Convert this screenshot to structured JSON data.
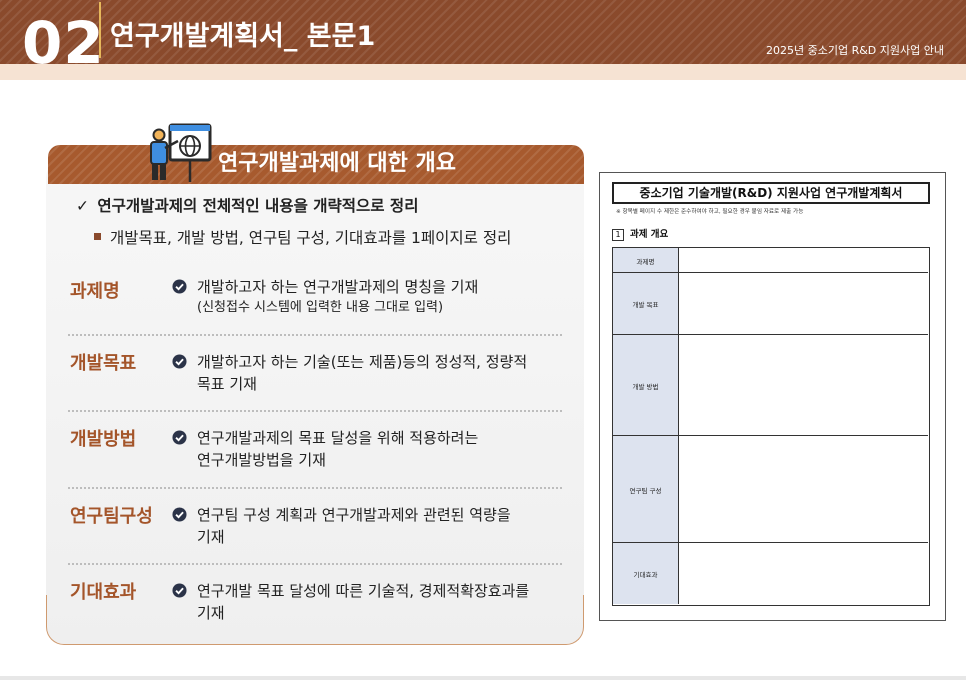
{
  "header": {
    "chapter_number": "02",
    "title": "연구개발계획서_ 본문1",
    "subtitle": "2025년 중소기업 R&D 지원사업 안내"
  },
  "section": {
    "title": "연구개발과제에 대한 개요",
    "icon": "presenter-globe-icon",
    "check_text": "연구개발과제의 전체적인 내용을 개략적으로 정리",
    "bullet_text": "개발목표, 개발 방법, 연구팀 구성, 기대효과를 1페이지로 정리"
  },
  "rows": [
    {
      "label": "과제명",
      "lines": [
        "개발하고자 하는 연구개발과제의 명칭을 기재"
      ],
      "note": "(신청접수 시스템에 입력한 내용 그대로 입력)"
    },
    {
      "label": "개발목표",
      "lines": [
        "개발하고자 하는 기술(또는 제품)등의 정성적, 정량적",
        "목표 기재"
      ]
    },
    {
      "label": "개발방법",
      "lines": [
        "연구개발과제의 목표 달성을 위해 적용하려는",
        "연구개발방법을 기재"
      ]
    },
    {
      "label": "연구팀구성",
      "lines": [
        "연구팀 구성 계획과 연구개발과제와 관련된 역량을",
        "기재"
      ]
    },
    {
      "label": "기대효과",
      "lines": [
        "연구개발 목표 달성에 따른 기술적, 경제적확장효과를",
        "기재"
      ]
    }
  ],
  "form": {
    "title": "중소기업 기술개발(R&D) 지원사업 연구개발계획서",
    "note": "※ 항목별 페이지 수 제한은 준수하여야 하고, 필요한 경우 붙임 자료로 제출 가능",
    "section_number": "1",
    "section_title": "과제 개요",
    "rows": [
      "과제명",
      "개발 목표",
      "개발 방법",
      "연구팀 구성",
      "기대효과"
    ]
  },
  "colors": {
    "header_brown": "#8a4a2c",
    "banner_brown": "#a75a2e",
    "label_brown": "#a4552a",
    "accent_gold": "#e7b95b",
    "form_label_bg": "#dde3ef"
  }
}
